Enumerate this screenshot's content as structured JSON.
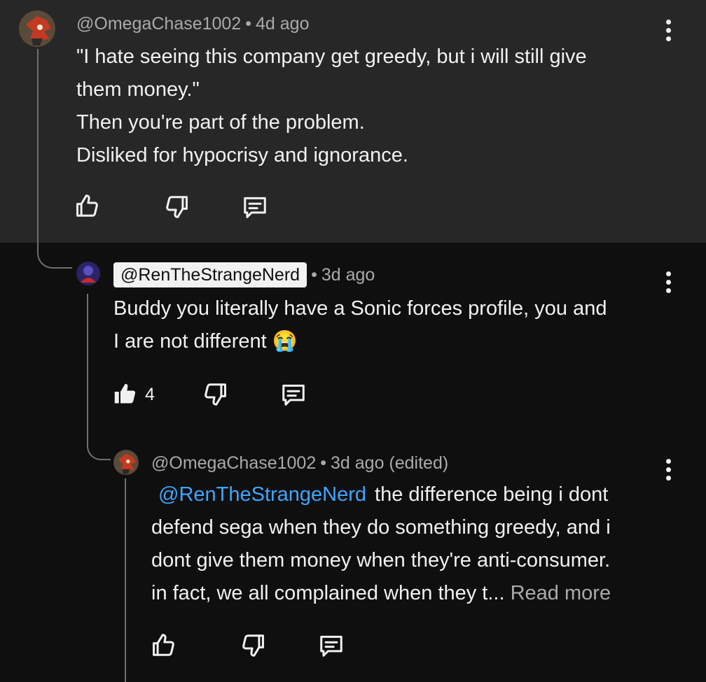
{
  "comments": [
    {
      "handle": "@OmegaChase1002",
      "time": "4d ago",
      "lines": [
        "\"I hate seeing this company get greedy, but i will still give",
        "them money.\"",
        "Then you're part of the problem.",
        "Disliked for hypocrisy and ignorance."
      ]
    },
    {
      "handle": "@RenTheStrangeNerd",
      "time": "3d ago",
      "line1": "Buddy you literally have a Sonic forces profile, you and",
      "line2": "I are not different",
      "emoji": "😭",
      "like_count": "4"
    },
    {
      "handle": "@OmegaChase1002",
      "time": "3d ago (edited)",
      "mention": "@RenTheStrangeNerd",
      "line1_rest": "the difference being i dont",
      "line2": "defend sega when they do something greedy, and i",
      "line3": "dont give them money when they're anti-consumer.",
      "line4": "in fact, we all complained when they t...",
      "read_more": "Read more"
    }
  ],
  "colors": {
    "highlight_bg": "#272727",
    "page_bg": "#0f0f0f",
    "mention": "#3ea6ff",
    "meta": "#aaaaaa"
  },
  "icons": [
    "like-icon",
    "dislike-icon",
    "reply-icon",
    "more-vert-icon"
  ]
}
